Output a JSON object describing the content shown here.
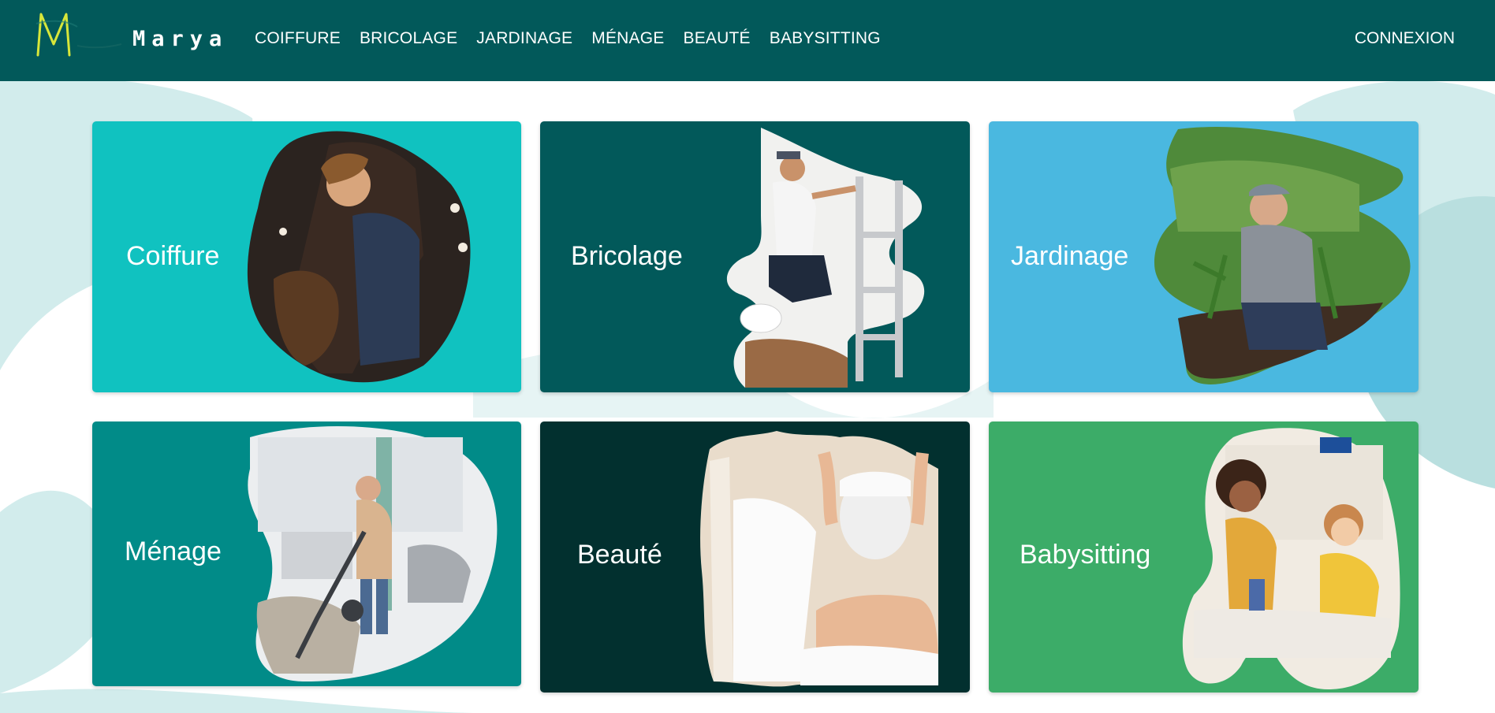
{
  "header": {
    "brand": "Marya",
    "nav": [
      "COIFFURE",
      "BRICOLAGE",
      "JARDINAGE",
      "MÉNAGE",
      "BEAUTÉ",
      "BABYSITTING"
    ],
    "login": "CONNEXION"
  },
  "cards": [
    {
      "title": "Coiffure",
      "color": "#10c2c0",
      "image": "hairdresser-photo"
    },
    {
      "title": "Bricolage",
      "color": "#02595a",
      "image": "painter-photo"
    },
    {
      "title": "Jardinage",
      "color": "#4ab8e0",
      "image": "gardener-photo"
    },
    {
      "title": "Ménage",
      "color": "#018b88",
      "image": "vacuum-photo"
    },
    {
      "title": "Beauté",
      "color": "#02302f",
      "image": "facial-mask-photo"
    },
    {
      "title": "Babysitting",
      "color": "#3cac68",
      "image": "children-photo"
    }
  ],
  "colors": {
    "header": "#02595a",
    "logo_accent": "#d7e63a",
    "background_blob": "#d2ecec"
  }
}
